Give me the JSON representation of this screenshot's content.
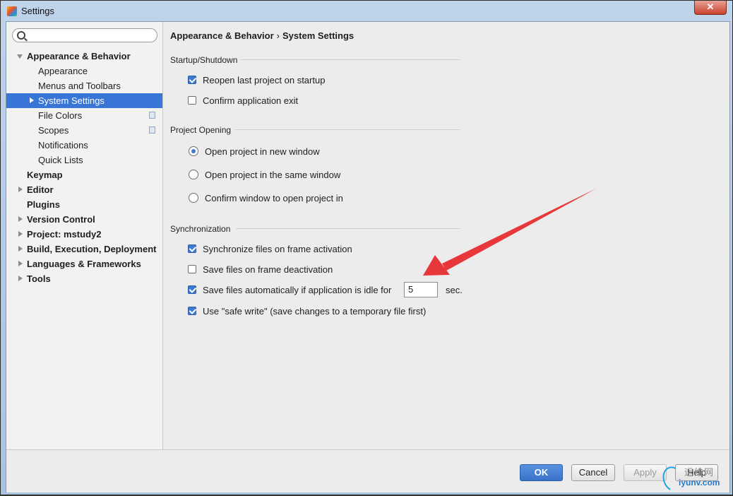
{
  "window": {
    "title": "Settings",
    "close_label": "✕"
  },
  "sidebar": {
    "search": {
      "value": "",
      "placeholder": ""
    },
    "items": [
      {
        "label": "Appearance & Behavior"
      },
      {
        "label": "Appearance"
      },
      {
        "label": "Menus and Toolbars"
      },
      {
        "label": "System Settings"
      },
      {
        "label": "File Colors"
      },
      {
        "label": "Scopes"
      },
      {
        "label": "Notifications"
      },
      {
        "label": "Quick Lists"
      },
      {
        "label": "Keymap"
      },
      {
        "label": "Editor"
      },
      {
        "label": "Plugins"
      },
      {
        "label": "Version Control"
      },
      {
        "label": "Project: mstudy2"
      },
      {
        "label": "Build, Execution, Deployment"
      },
      {
        "label": "Languages & Frameworks"
      },
      {
        "label": "Tools"
      }
    ]
  },
  "main": {
    "breadcrumb": {
      "parent": "Appearance & Behavior",
      "separator": "›",
      "current": "System Settings"
    },
    "startup": {
      "title": "Startup/Shutdown",
      "reopen_label": "Reopen last project on startup",
      "reopen_checked": true,
      "confirm_exit_label": "Confirm application exit",
      "confirm_exit_checked": false
    },
    "project_opening": {
      "title": "Project Opening",
      "options": [
        {
          "label": "Open project in new window",
          "selected": true
        },
        {
          "label": "Open project in the same window",
          "selected": false
        },
        {
          "label": "Confirm window to open project in",
          "selected": false
        }
      ]
    },
    "sync": {
      "title": "Synchronization",
      "sync_label": "Synchronize files on frame activation",
      "sync_checked": true,
      "save_deactivation_label": "Save files on frame deactivation",
      "save_deactivation_checked": false,
      "save_idle_label": "Save files automatically if application is idle for",
      "save_idle_checked": true,
      "idle_seconds": "5",
      "idle_unit": "sec.",
      "safe_write_label": "Use \"safe write\" (save changes to a temporary file first)",
      "safe_write_checked": true
    }
  },
  "footer": {
    "ok": "OK",
    "cancel": "Cancel",
    "apply": "Apply",
    "help": "Help"
  },
  "watermark": {
    "top": "运维网",
    "bottom": "iyunv.com"
  },
  "colors": {
    "selection": "#3875d7",
    "primary_button": "#3873c9",
    "annotation_arrow": "#e8373a"
  }
}
